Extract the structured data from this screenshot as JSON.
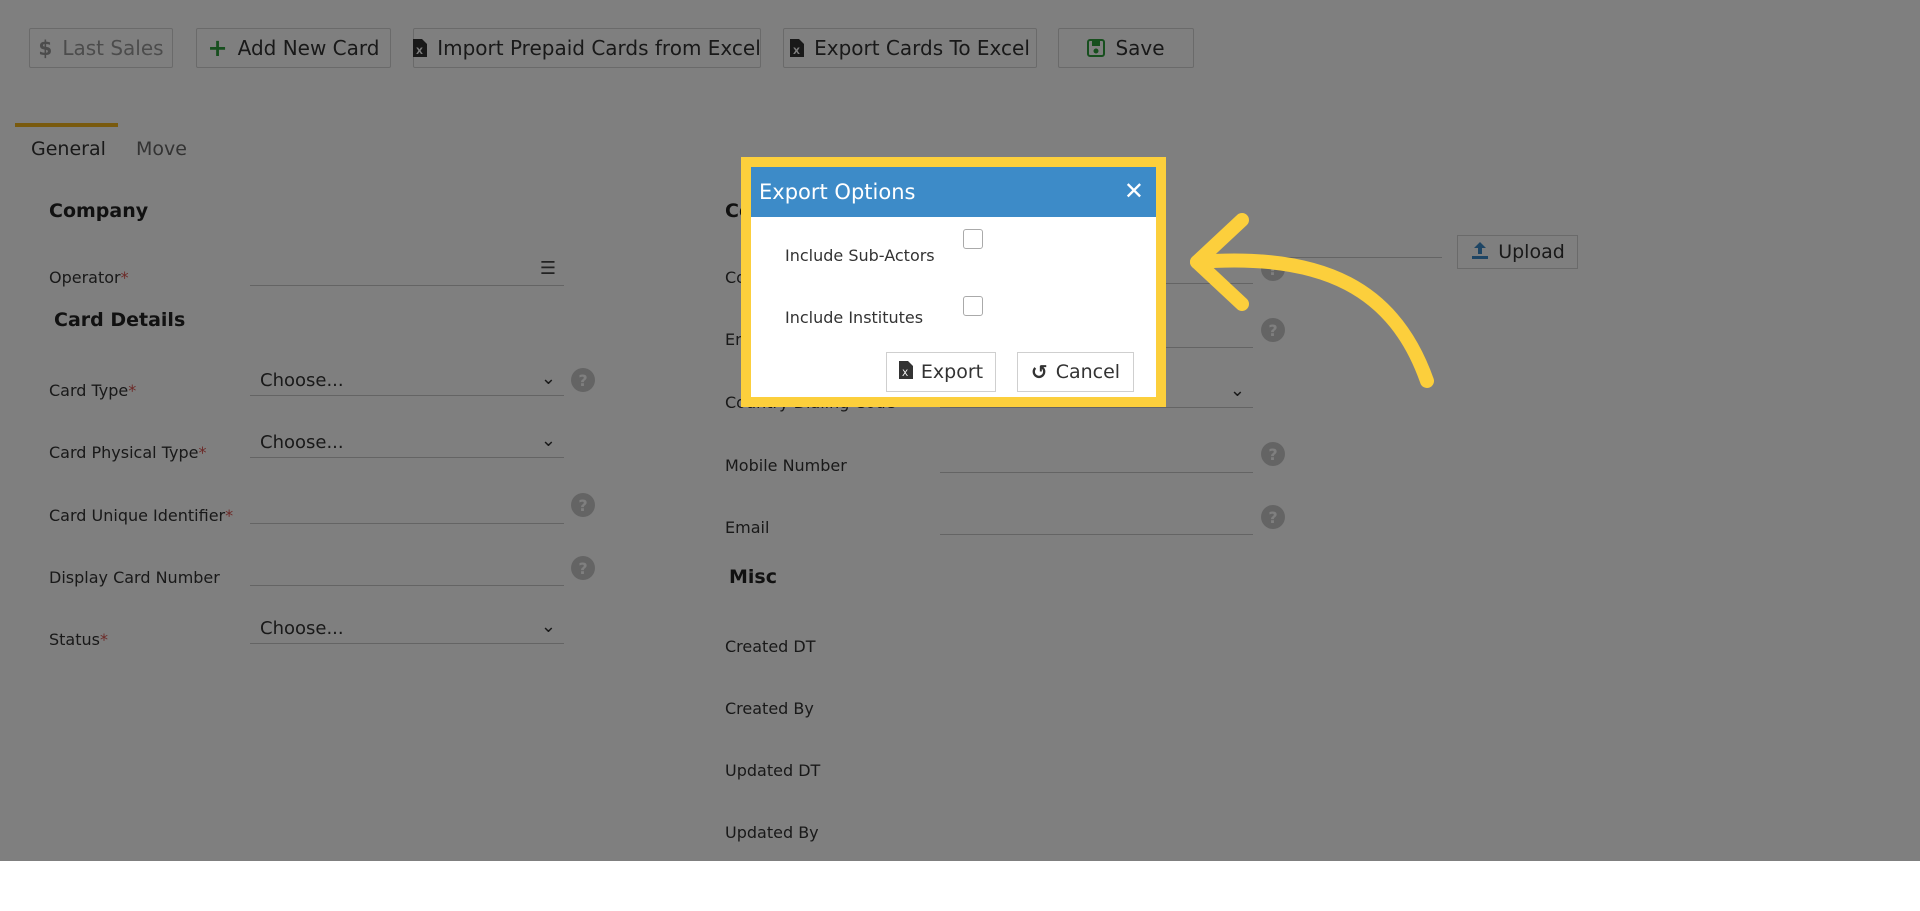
{
  "toolbar": {
    "last_sales": "Last Sales",
    "add_new_card": "Add New Card",
    "import_prepaid": "Import Prepaid Cards from Excel",
    "export_cards": "Export Cards To Excel",
    "save": "Save"
  },
  "tabs": {
    "general": "General",
    "move": "Move"
  },
  "company": {
    "title": "Company",
    "operator_label": "Operator"
  },
  "card_details": {
    "title": "Card Details",
    "card_type_label": "Card Type",
    "card_type_value": "Choose...",
    "physical_type_label": "Card Physical Type",
    "physical_type_value": "Choose...",
    "unique_id_label": "Card Unique Identifier",
    "display_number_label": "Display Card Number",
    "status_label": "Status",
    "status_value": "Choose..."
  },
  "contact": {
    "title_partial": "Co",
    "field1_partial": "Co",
    "field2_partial": "En",
    "dialing_code_partial": "Country Dialing Code",
    "mobile_label": "Mobile Number",
    "email_label": "Email",
    "upload_label": "Upload"
  },
  "misc": {
    "title": "Misc",
    "created_dt": "Created DT",
    "created_by": "Created By",
    "updated_dt": "Updated DT",
    "updated_by": "Updated By"
  },
  "modal": {
    "title": "Export Options",
    "include_sub_actors": "Include Sub-Actors",
    "include_institutes": "Include Institutes",
    "export_label": "Export",
    "cancel_label": "Cancel"
  },
  "colors": {
    "highlight": "#fccf3c",
    "modal_header": "#3d8bc8",
    "tab_active": "#f2b41c"
  }
}
